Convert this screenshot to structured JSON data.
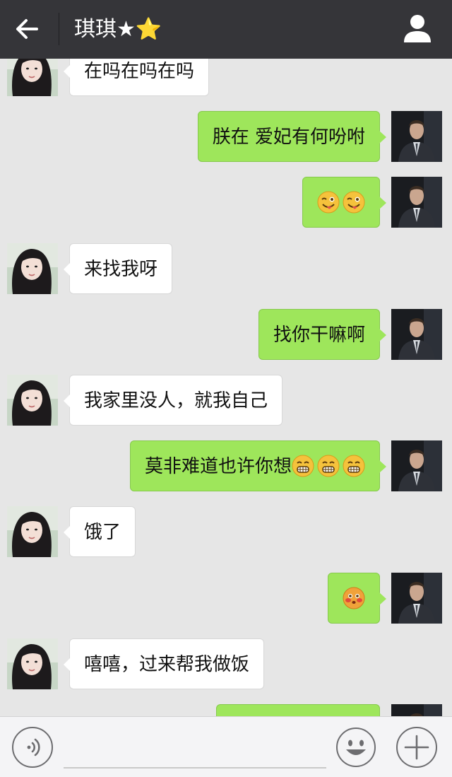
{
  "header": {
    "title": "琪琪★⭐",
    "back_icon": "arrow-left-icon",
    "profile_icon": "person-icon"
  },
  "messages": [
    {
      "side": "left",
      "text": "在吗在吗在吗",
      "emoji": []
    },
    {
      "side": "right",
      "text": "朕在  爱妃有何吩咐",
      "emoji": []
    },
    {
      "side": "right",
      "text": "",
      "emoji": [
        "wink-tongue",
        "wink-tongue"
      ]
    },
    {
      "side": "left",
      "text": "来找我呀",
      "emoji": []
    },
    {
      "side": "right",
      "text": "找你干嘛啊",
      "emoji": []
    },
    {
      "side": "left",
      "text": "我家里没人，就我自己",
      "emoji": []
    },
    {
      "side": "right",
      "text": "莫非难道也许你想",
      "emoji": [
        "grin",
        "grin",
        "grin"
      ]
    },
    {
      "side": "left",
      "text": "饿了",
      "emoji": []
    },
    {
      "side": "right",
      "text": "",
      "emoji": [
        "blush"
      ]
    },
    {
      "side": "left",
      "text": "嘻嘻，过来帮我做饭",
      "emoji": []
    },
    {
      "side": "right",
      "text": "",
      "emoji": []
    }
  ],
  "composer": {
    "voice_icon": "voice-icon",
    "emoji_icon": "smiley-icon",
    "plus_icon": "plus-icon"
  },
  "colors": {
    "header_bg": "#353539",
    "chat_bg": "#e6e6e6",
    "sent_bubble": "#9ee65b",
    "received_bubble": "#ffffff"
  }
}
